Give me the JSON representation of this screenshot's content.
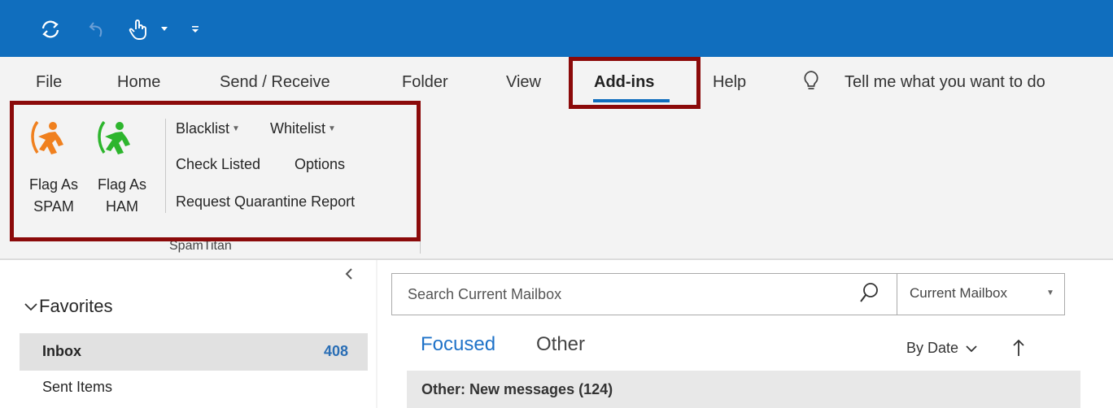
{
  "ribbon_tabs": {
    "file": "File",
    "home": "Home",
    "send_receive": "Send / Receive",
    "folder": "Folder",
    "view": "View",
    "addins": "Add-ins",
    "help": "Help",
    "tell_me": "Tell me what you want to do"
  },
  "spamtitan": {
    "flag_spam_line1": "Flag As",
    "flag_spam_line2": "SPAM",
    "flag_ham_line1": "Flag As",
    "flag_ham_line2": "HAM",
    "blacklist": "Blacklist",
    "whitelist": "Whitelist",
    "check_listed": "Check Listed",
    "options": "Options",
    "request_quarantine": "Request Quarantine Report",
    "group_label": "SpamTitan",
    "spam_color": "#f0801e",
    "ham_color": "#2db52d"
  },
  "folders": {
    "favorites": "Favorites",
    "inbox": "Inbox",
    "inbox_count": "408",
    "sent_items": "Sent Items"
  },
  "search": {
    "placeholder": "Search Current Mailbox",
    "scope": "Current Mailbox"
  },
  "messages": {
    "focused": "Focused",
    "other": "Other",
    "sort": "By Date",
    "group_header": "Other: New messages (124)"
  },
  "colors": {
    "titlebar": "#106ebe",
    "accent": "#1e72c8",
    "highlight_box": "#8b0a0a"
  }
}
